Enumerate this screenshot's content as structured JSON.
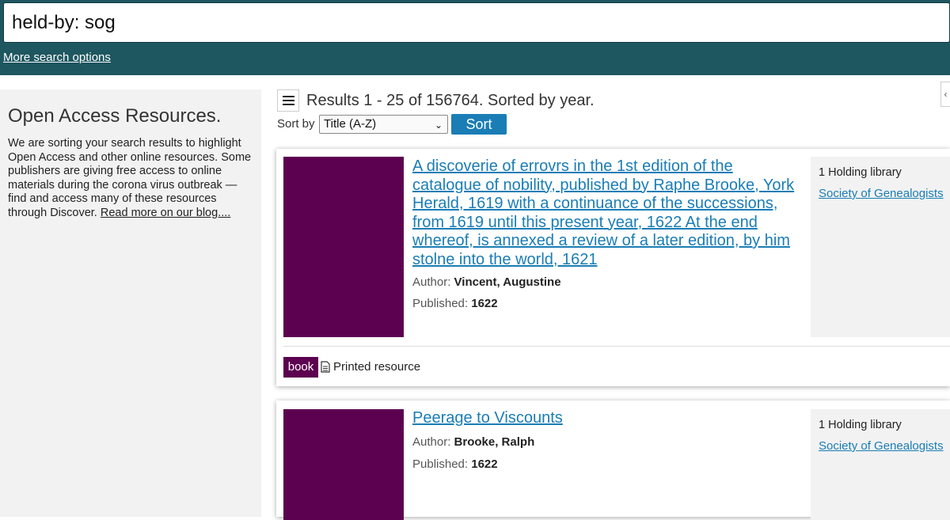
{
  "search": {
    "query": "held-by: sog",
    "more_options_label": "More search options"
  },
  "sidebar": {
    "title": "Open Access Resources.",
    "text": "We are sorting your search results to highlight Open Access and other online resources. Some publishers are giving free access to online materials during the corona virus outbreak — find and access many of these resources through Discover. ",
    "link_text": "Read more on our blog...."
  },
  "results": {
    "summary": "Results 1 - 25 of 156764. Sorted by year.",
    "sort_label": "Sort by",
    "sort_selected": "Title (A-Z)",
    "sort_button": "Sort"
  },
  "items": [
    {
      "title": "A discoverie of errovrs in the 1st edition of the catalogue of nobility, published by Raphe Brooke, York Herald, 1619 with a continuance of the successions, from 1619 until this present year, 1622 At the end whereof, is annexed a review of a later edition, by him stolne into the world, 1621",
      "author_label": "Author:",
      "author": "Vincent, Augustine",
      "published_label": "Published:",
      "published": "1622",
      "holding_count": "1 Holding library",
      "holding_library": "Society of Genealogists",
      "format_badge": "book",
      "format_text": "Printed resource"
    },
    {
      "title": "Peerage to Viscounts",
      "author_label": "Author:",
      "author": "Brooke, Ralph",
      "published_label": "Published:",
      "published": "1622",
      "holding_count": "1 Holding library",
      "holding_library": "Society of Genealogists"
    }
  ],
  "colors": {
    "topbar": "#1e5760",
    "link": "#1a7db5",
    "cover": "#5c0050",
    "sort_button": "#1a7db5"
  },
  "icons": {
    "menu": "hamburger-menu-icon",
    "format": "document-icon",
    "select": "chevron-down-icon",
    "collapse": "chevron-left-icon"
  }
}
